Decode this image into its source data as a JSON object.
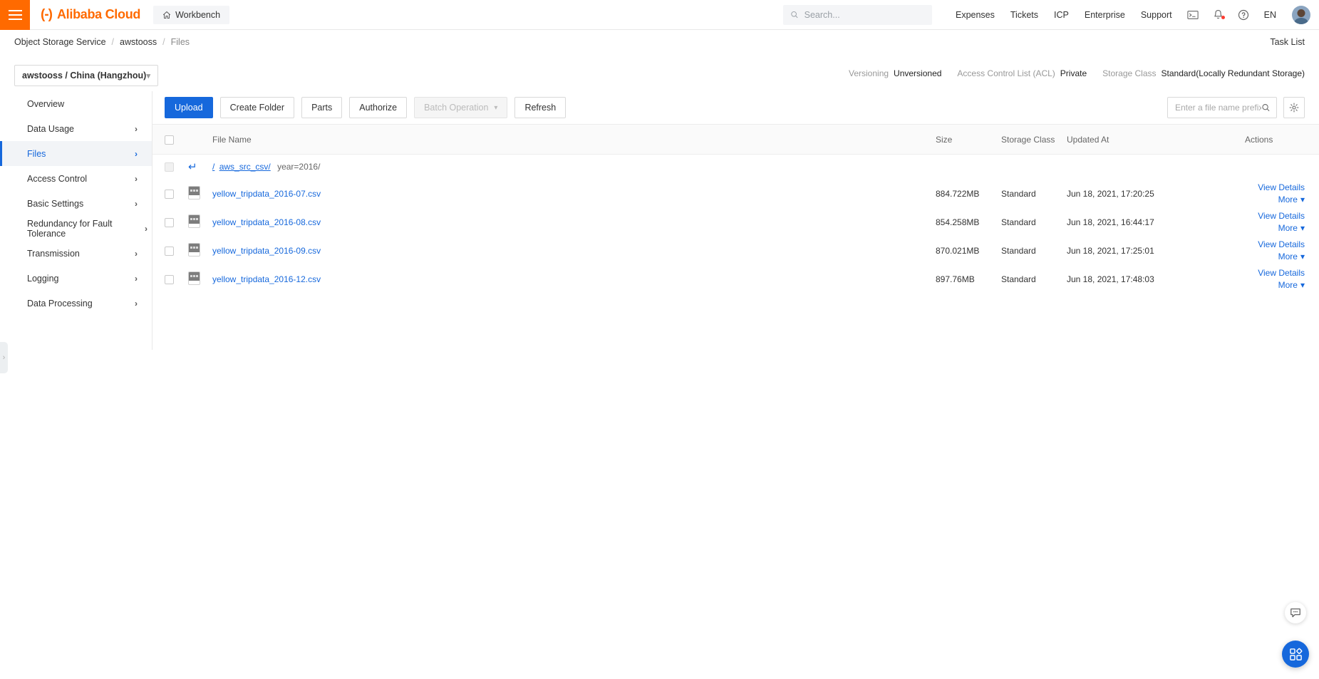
{
  "topbar": {
    "menu_icon": "hamburger-icon",
    "brand_mark": "(-)",
    "brand_text": "Alibaba Cloud",
    "workbench_label": "Workbench",
    "workbench_icon": "home-icon",
    "search_placeholder": "Search...",
    "search_value": "",
    "links": [
      "Expenses",
      "Tickets",
      "ICP",
      "Enterprise",
      "Support"
    ],
    "icons": [
      "terminal-icon",
      "bell-icon",
      "help-icon"
    ],
    "language": "EN",
    "avatar": "user-avatar"
  },
  "breadcrumb": {
    "items": [
      "Object Storage Service",
      "awstooss",
      "Files"
    ],
    "separator": "/",
    "task_list_label": "Task List"
  },
  "bucket": {
    "selected": "awstooss / China (Hangzhou)",
    "chevron": "chevron-down-icon"
  },
  "meta": [
    {
      "label": "Versioning",
      "value": "Unversioned"
    },
    {
      "label": "Access Control List (ACL)",
      "value": "Private"
    },
    {
      "label": "Storage Class",
      "value": "Standard(Locally Redundant Storage)"
    }
  ],
  "sidebar": {
    "items": [
      {
        "label": "Overview",
        "chevron": false,
        "active": false
      },
      {
        "label": "Data Usage",
        "chevron": true,
        "active": false
      },
      {
        "label": "Files",
        "chevron": true,
        "active": true
      },
      {
        "label": "Access Control",
        "chevron": true,
        "active": false
      },
      {
        "label": "Basic Settings",
        "chevron": true,
        "active": false
      },
      {
        "label": "Redundancy for Fault Tolerance",
        "chevron": true,
        "active": false
      },
      {
        "label": "Transmission",
        "chevron": true,
        "active": false
      },
      {
        "label": "Logging",
        "chevron": true,
        "active": false
      },
      {
        "label": "Data Processing",
        "chevron": true,
        "active": false
      }
    ],
    "collapse_handle": "chevron-right-icon"
  },
  "toolbar": {
    "buttons": [
      {
        "label": "Upload",
        "style": "primary",
        "chevron": false
      },
      {
        "label": "Create Folder",
        "style": "default",
        "chevron": false
      },
      {
        "label": "Parts",
        "style": "default",
        "chevron": false
      },
      {
        "label": "Authorize",
        "style": "default",
        "chevron": false
      },
      {
        "label": "Batch Operation",
        "style": "disabled",
        "chevron": true
      },
      {
        "label": "Refresh",
        "style": "default",
        "chevron": false
      }
    ],
    "prefix_placeholder": "Enter a file name prefix",
    "prefix_value": "",
    "search_icon": "search-icon",
    "settings_icon": "gear-icon"
  },
  "table": {
    "headers": {
      "file_name": "File Name",
      "size": "Size",
      "storage_class": "Storage Class",
      "updated_at": "Updated At",
      "actions": "Actions"
    },
    "path_row": {
      "back_icon": "back-arrow-icon",
      "root": "/",
      "parent_link": "aws_src_csv/",
      "current": "year=2016/"
    },
    "rows": [
      {
        "name": "yellow_tripdata_2016-07.csv",
        "size": "884.722MB",
        "storage_class": "Standard",
        "updated_at": "Jun 18, 2021, 17:20:25",
        "view_details": "View Details",
        "more": "More"
      },
      {
        "name": "yellow_tripdata_2016-08.csv",
        "size": "854.258MB",
        "storage_class": "Standard",
        "updated_at": "Jun 18, 2021, 16:44:17",
        "view_details": "View Details",
        "more": "More"
      },
      {
        "name": "yellow_tripdata_2016-09.csv",
        "size": "870.021MB",
        "storage_class": "Standard",
        "updated_at": "Jun 18, 2021, 17:25:01",
        "view_details": "View Details",
        "more": "More"
      },
      {
        "name": "yellow_tripdata_2016-12.csv",
        "size": "897.76MB",
        "storage_class": "Standard",
        "updated_at": "Jun 18, 2021, 17:48:03",
        "view_details": "View Details",
        "more": "More"
      }
    ]
  },
  "floating": {
    "chat_icon": "chat-bubble-icon",
    "apps_icon": "apps-grid-icon"
  },
  "colors": {
    "brand_orange": "#ff6a00",
    "link_blue": "#1668dc",
    "badge_red": "#ff3b30"
  }
}
